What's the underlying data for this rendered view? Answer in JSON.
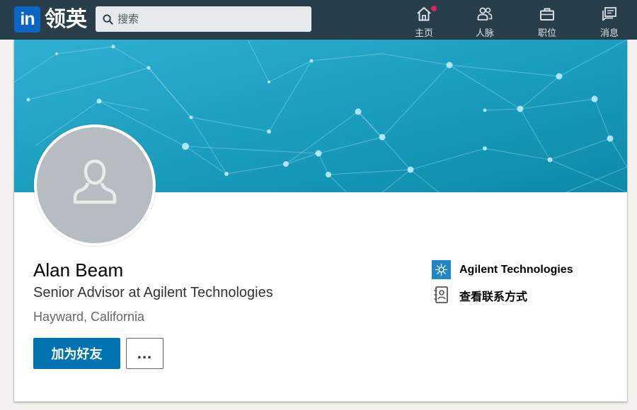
{
  "nav": {
    "logo_text": "in",
    "brand_name": "领英",
    "search_placeholder": "搜索",
    "items": [
      {
        "label": "主页",
        "icon": "home-icon",
        "has_notification": true
      },
      {
        "label": "人脉",
        "icon": "people-icon"
      },
      {
        "label": "职位",
        "icon": "briefcase-icon"
      },
      {
        "label": "消息",
        "icon": "messages-icon"
      }
    ]
  },
  "profile": {
    "name": "Alan Beam",
    "headline": "Senior Advisor at Agilent Technologies",
    "location": "Hayward, California",
    "connect_label": "加为好友",
    "more_label": "...",
    "company": "Agilent Technologies",
    "contact_info_label": "查看联系方式"
  },
  "colors": {
    "nav_bg": "#283e4a",
    "logo_blue": "#0a66c2",
    "banner_teal": "#1a9cbc",
    "connect_button": "#0073b1",
    "notification": "#e0245e"
  }
}
